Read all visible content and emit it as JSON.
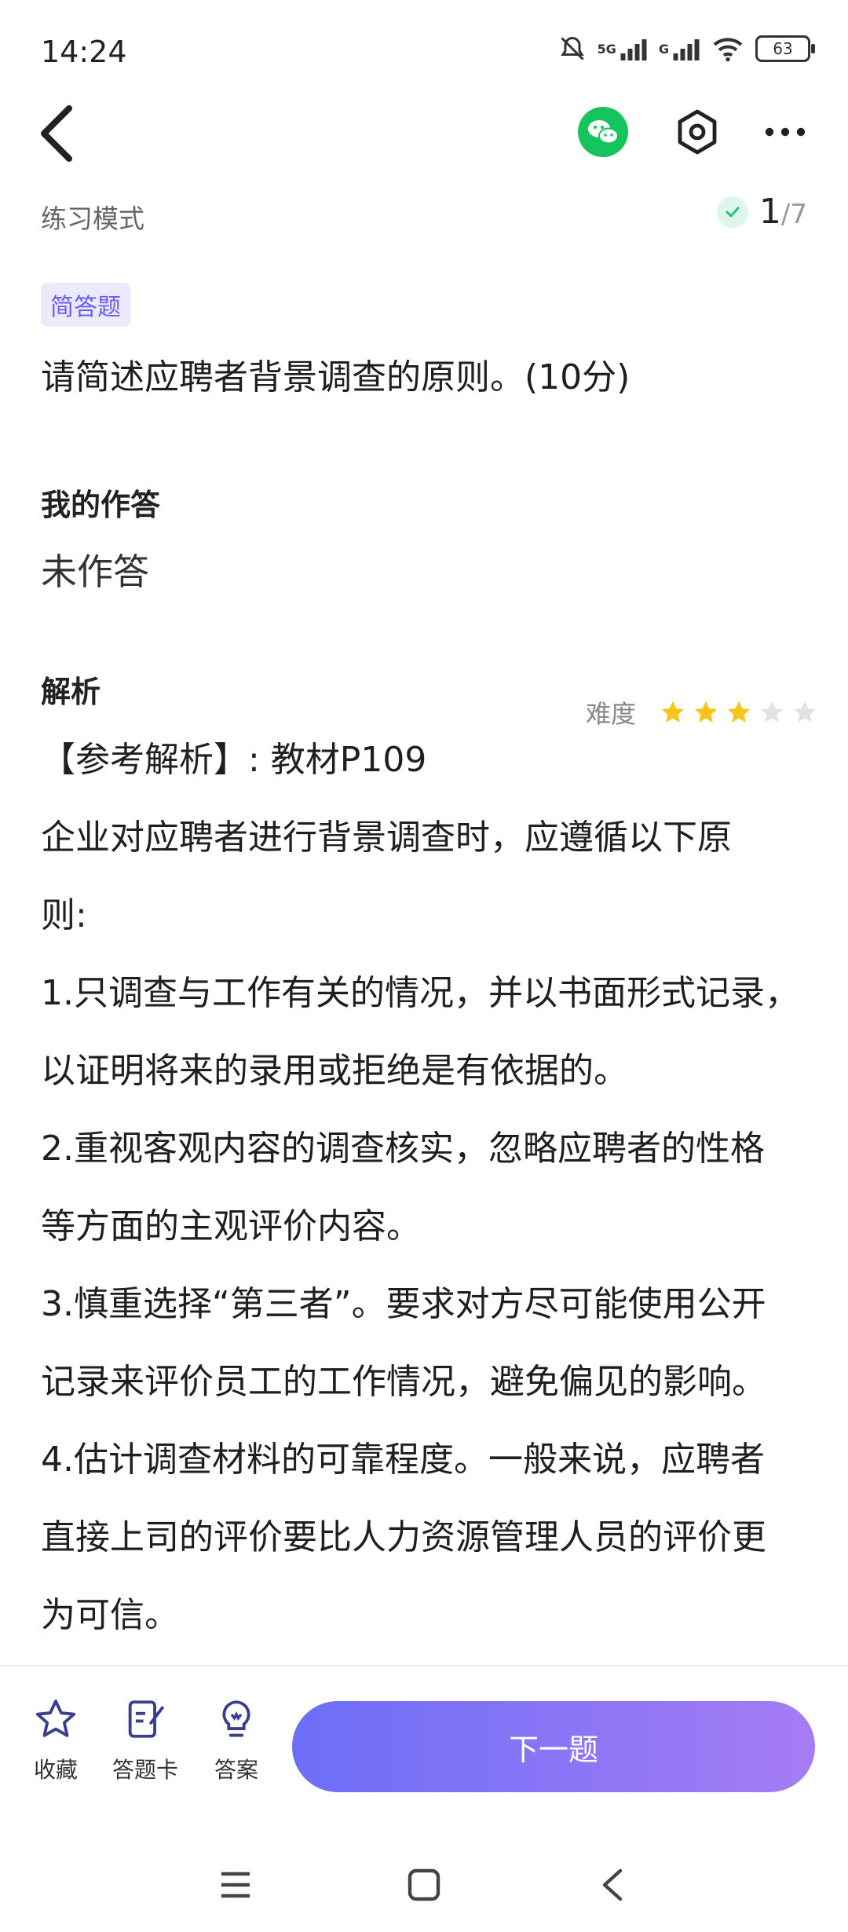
{
  "status_bar": {
    "time": "14:24",
    "battery": "63",
    "signal_1": "5G",
    "signal_2": "G"
  },
  "header": {
    "mode": "练习模式",
    "progress_current": "1",
    "progress_total": "/7"
  },
  "question": {
    "type": "简答题",
    "text": "请简述应聘者背景调查的原则。(10分)"
  },
  "my_answer": {
    "title": "我的作答",
    "value": "未作答"
  },
  "analysis": {
    "title": "解析",
    "difficulty_label": "难度",
    "difficulty_rating": 3,
    "difficulty_max": 5,
    "lines": [
      "【参考解析】: 教材P109",
      "企业对应聘者进行背景调查时，应遵循以下原",
      "则:",
      "1.只调查与工作有关的情况，并以书面形式记录，",
      "以证明将来的录用或拒绝是有依据的。",
      "2.重视客观内容的调查核实，忽略应聘者的性格",
      "等方面的主观评价内容。",
      "3.慎重选择“第三者”。要求对方尽可能使用公开",
      "记录来评价员工的工作情况，避免偏见的影响。",
      "4.估计调查材料的可靠程度。一般来说，应聘者",
      "直接上司的评价要比人力资源管理人员的评价更",
      "为可信。"
    ]
  },
  "bottom_bar": {
    "favorite_label": "收藏",
    "answer_card_label": "答题卡",
    "answer_label": "答案",
    "next_label": "下一题"
  },
  "icons": {
    "back": "chevron-left-icon",
    "share": "wechat-icon",
    "settings": "hexagon-settings-icon",
    "more": "more-horizontal-icon"
  },
  "colors": {
    "accent": "#6a5cf0",
    "star_active": "#f5c518",
    "star_inactive": "#e2e2e2",
    "wechat": "#15c45c"
  }
}
